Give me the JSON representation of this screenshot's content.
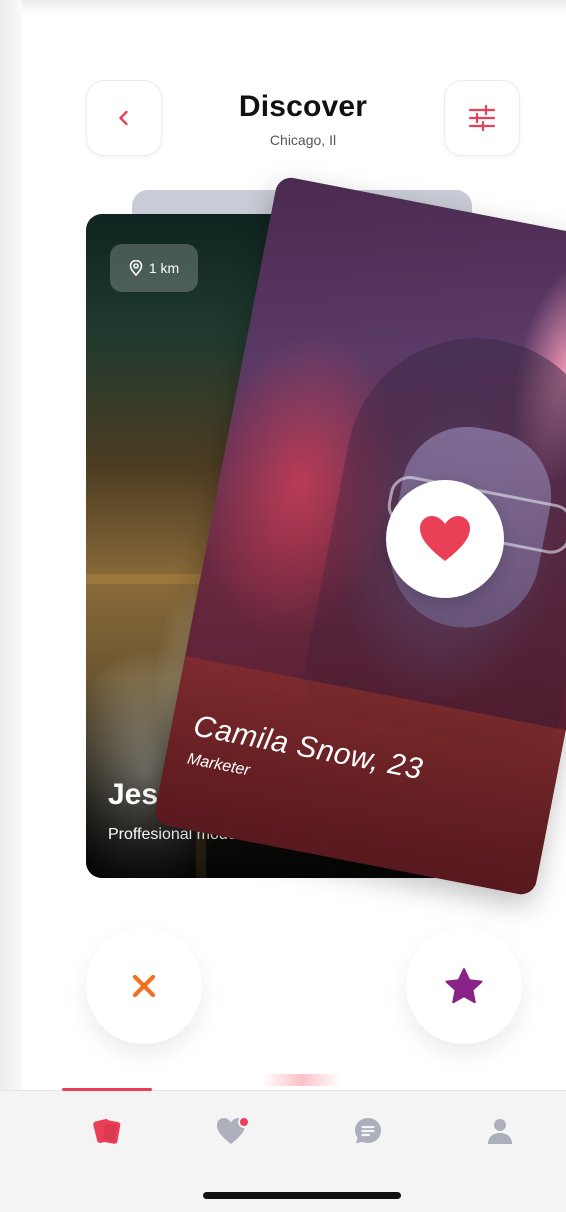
{
  "header": {
    "title": "Discover",
    "location": "Chicago, Il"
  },
  "cards": {
    "back": {
      "distance": "1 km",
      "name": "Jes",
      "role": "Proffesional mode"
    },
    "front": {
      "name": "Camila Snow, 23",
      "role": "Marketer"
    }
  },
  "icons": {
    "back": "chevron-left-icon",
    "filter": "sliders-icon",
    "location": "location-pin-icon",
    "like": "heart-icon",
    "dislike": "close-icon",
    "superlike": "star-icon",
    "tabs": [
      "cards-icon",
      "heart-notification-icon",
      "chat-icon",
      "person-icon"
    ]
  },
  "colors": {
    "accent": "#E94057",
    "dislike": "#F27121",
    "superlike": "#8A2387",
    "tab_inactive": "#ADAFBB"
  }
}
